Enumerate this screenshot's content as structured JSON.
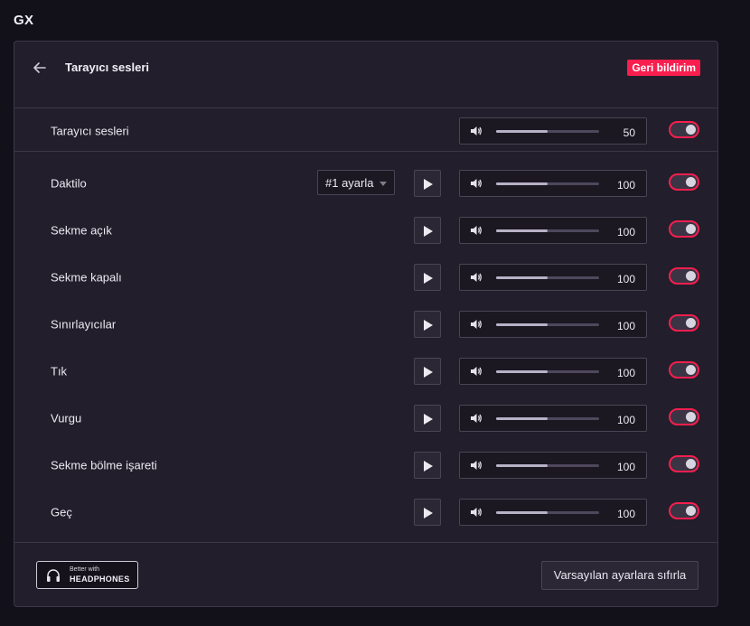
{
  "app": {
    "title": "GX"
  },
  "header": {
    "title": "Tarayıcı sesleri",
    "feedback_label": "Geri bildirim"
  },
  "master": {
    "label": "Tarayıcı sesleri",
    "volume": 50,
    "enabled": true
  },
  "sounds": [
    {
      "label": "Daktilo",
      "volume": 100,
      "enabled": true,
      "preset": "#1 ayarla"
    },
    {
      "label": "Sekme açık",
      "volume": 100,
      "enabled": true
    },
    {
      "label": "Sekme kapalı",
      "volume": 100,
      "enabled": true
    },
    {
      "label": "Sınırlayıcılar",
      "volume": 100,
      "enabled": true
    },
    {
      "label": "Tık",
      "volume": 100,
      "enabled": true
    },
    {
      "label": "Vurgu",
      "volume": 100,
      "enabled": true
    },
    {
      "label": "Sekme bölme işareti",
      "volume": 100,
      "enabled": true
    },
    {
      "label": "Geç",
      "volume": 100,
      "enabled": true
    }
  ],
  "slider_fill_fraction": 0.5,
  "footer": {
    "headphones_small": "Better with",
    "headphones_big": "HEADPHONES",
    "reset_label": "Varsayılan ayarlara sıfırla"
  },
  "colors": {
    "accent": "#fa1e4e",
    "background": "#121019",
    "panel": "#221e2b"
  },
  "icons": [
    "back-arrow-icon",
    "speaker-icon",
    "play-icon",
    "headphones-icon",
    "caret-down-icon"
  ]
}
